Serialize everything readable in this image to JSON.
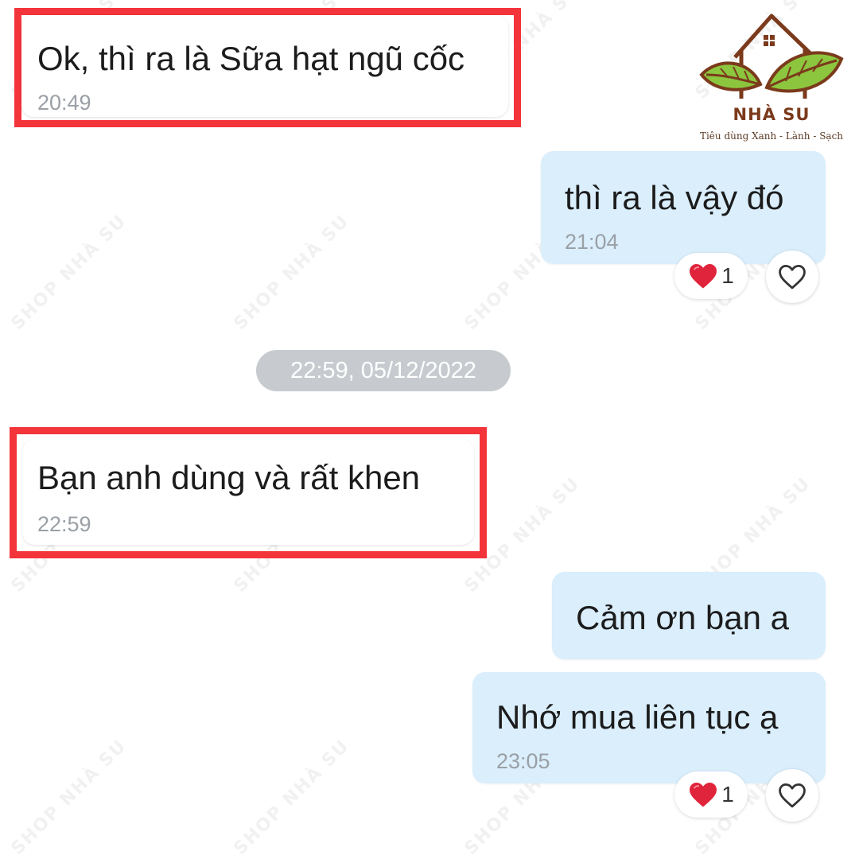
{
  "logo": {
    "name": "NHÀ SU",
    "tagline": "Tiêu dùng Xanh - Lành - Sạch"
  },
  "watermark": "SHOP NHÀ SU",
  "messages": [
    {
      "direction": "incoming",
      "text": "Ok, thì ra là Sữa hạt ngũ cốc",
      "time": "20:49",
      "highlighted": true
    },
    {
      "direction": "outgoing",
      "text": "thì ra là vậy đó",
      "time": "21:04",
      "reaction": {
        "icon": "heart-icon",
        "count": "1"
      }
    },
    {
      "direction": "incoming",
      "text": "Bạn anh dùng và rất khen",
      "time": "22:59",
      "highlighted": true
    },
    {
      "direction": "outgoing",
      "text": "Cảm ơn bạn a"
    },
    {
      "direction": "outgoing",
      "text": "Nhớ mua liên tục ạ",
      "time": "23:05",
      "reaction": {
        "icon": "heart-icon",
        "count": "1"
      }
    }
  ],
  "date_separator": "22:59, 05/12/2022",
  "colors": {
    "highlight": "#f4343b",
    "outgoing_bubble": "#daeefc",
    "incoming_bubble": "#ffffff",
    "timestamp": "#9aa0a6",
    "date_pill": "#c7cbcf",
    "heart": "#e0243b",
    "logo_brown": "#7b3a1b",
    "logo_leaf": "#8cc63f"
  }
}
